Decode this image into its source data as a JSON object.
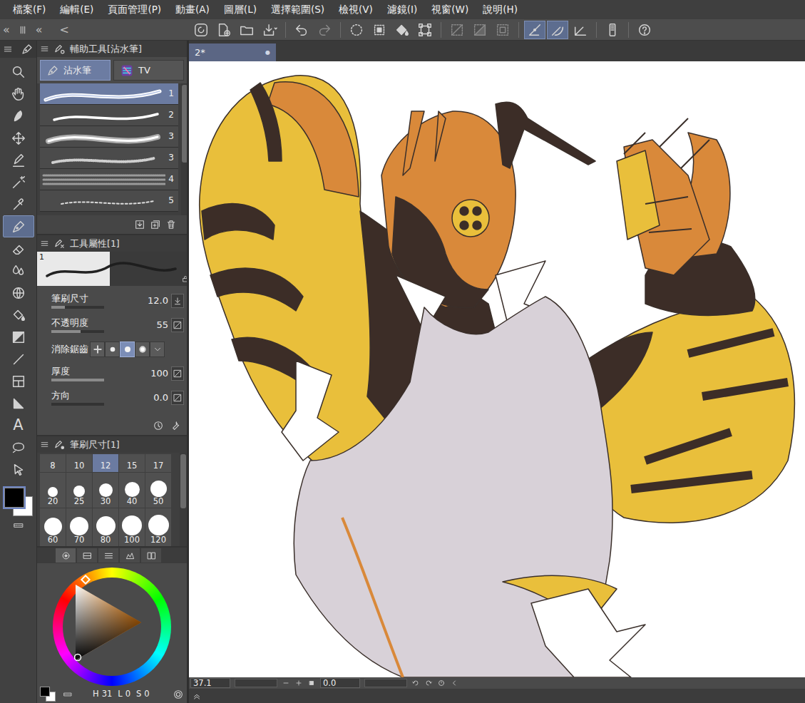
{
  "menu": [
    "檔案(F)",
    "編輯(E)",
    "頁面管理(P)",
    "動畫(A)",
    "圖層(L)",
    "選擇範圍(S)",
    "檢視(V)",
    "濾鏡(I)",
    "視窗(W)",
    "說明(H)"
  ],
  "dock_controls": [
    "«",
    "«",
    "<"
  ],
  "command_bar": [
    {
      "selected": false,
      "disabled": false
    },
    {
      "selected": false,
      "disabled": false
    },
    {
      "selected": false,
      "disabled": false
    },
    {
      "selected": false,
      "disabled": false
    },
    {
      "selected": false,
      "disabled": false
    },
    {
      "selected": false,
      "disabled": true
    },
    {
      "selected": false,
      "disabled": false
    },
    {
      "selected": false,
      "disabled": false
    },
    {
      "selected": false,
      "disabled": false
    },
    {
      "selected": false,
      "disabled": false
    },
    {
      "selected": false,
      "disabled": true
    },
    {
      "selected": false,
      "disabled": true
    },
    {
      "selected": false,
      "disabled": true
    },
    {
      "selected": true,
      "disabled": false
    },
    {
      "selected": true,
      "disabled": false
    },
    {
      "selected": false,
      "disabled": false
    },
    {
      "selected": false,
      "disabled": false
    },
    {
      "selected": false,
      "disabled": false
    }
  ],
  "tools": [
    {
      "selected": false
    },
    {
      "selected": false
    },
    {
      "selected": false
    },
    {
      "selected": false
    },
    {
      "selected": false
    },
    {
      "selected": false
    },
    {
      "selected": false
    },
    {
      "selected": true
    },
    {
      "selected": false
    },
    {
      "selected": false
    },
    {
      "selected": false
    },
    {
      "selected": false
    },
    {
      "selected": false
    },
    {
      "selected": false
    },
    {
      "selected": false
    },
    {
      "selected": false
    },
    {
      "selected": false,
      "glyph": "A"
    },
    {
      "selected": false
    },
    {
      "selected": false
    }
  ],
  "swatches": [
    {
      "color": "#000000",
      "selected": true
    },
    {
      "color": "#ffffff",
      "selected": false
    }
  ],
  "subtool": {
    "title": "輔助工具[沾水筆]",
    "groups": [
      {
        "label": "沾水筆",
        "selected": true
      },
      {
        "label": "TV",
        "selected": false
      }
    ],
    "brushes": [
      {
        "number": "1",
        "selected": true
      },
      {
        "number": "2",
        "selected": false
      },
      {
        "number": "3",
        "selected": false
      },
      {
        "number": "3",
        "selected": false
      },
      {
        "number": "4",
        "selected": false
      },
      {
        "number": "5",
        "selected": false
      }
    ]
  },
  "tool_property": {
    "title": "工具屬性[1]",
    "preview_number": "1",
    "props": [
      {
        "kind": "slider",
        "label": "筆刷尺寸",
        "value": "12.0",
        "level": 0.25
      },
      {
        "kind": "slider",
        "label": "不透明度",
        "value": "55",
        "level": 0.55
      },
      {
        "kind": "choice",
        "label": "消除鋸齒",
        "options": [
          {
            "selected": false
          },
          {
            "selected": false
          },
          {
            "selected": true
          },
          {
            "selected": false
          }
        ]
      },
      {
        "kind": "slider",
        "label": "厚度",
        "value": "100",
        "level": 1.0
      },
      {
        "kind": "slider",
        "label": "方向",
        "value": "0.0",
        "level": 0.0
      }
    ]
  },
  "brush_size": {
    "title": "筆刷尺寸[1]",
    "sizes": [
      {
        "label": "8",
        "selected": false
      },
      {
        "label": "10",
        "selected": false
      },
      {
        "label": "12",
        "selected": true
      },
      {
        "label": "15",
        "selected": false
      },
      {
        "label": "17",
        "selected": false
      },
      {
        "label": "20",
        "selected": false
      },
      {
        "label": "25",
        "selected": false
      },
      {
        "label": "30",
        "selected": false
      },
      {
        "label": "40",
        "selected": false
      },
      {
        "label": "50",
        "selected": false
      },
      {
        "label": "60",
        "selected": false
      },
      {
        "label": "70",
        "selected": false
      },
      {
        "label": "80",
        "selected": false
      },
      {
        "label": "100",
        "selected": false
      },
      {
        "label": "120",
        "selected": false
      }
    ]
  },
  "color_panel": {
    "tabs": [
      {
        "selected": true
      },
      {
        "selected": false
      },
      {
        "selected": false
      },
      {
        "selected": false
      },
      {
        "selected": false
      }
    ],
    "values": [
      {
        "label": "H",
        "value": "31"
      },
      {
        "label": "L",
        "value": "0"
      },
      {
        "label": "S",
        "value": "0"
      }
    ]
  },
  "document_tab": {
    "label": "2*",
    "dot": "●"
  },
  "status_bar": {
    "zoom": "37.1",
    "angle": "0.0"
  }
}
